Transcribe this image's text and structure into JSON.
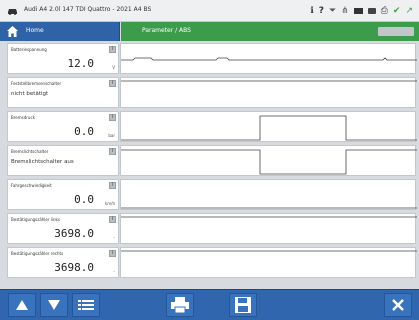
{
  "titlebar": {
    "title": "Audi A4 2.0l 147 TDI Quattro - 2021 A4 BS"
  },
  "header": {
    "home_label": "Home",
    "param_title": "Parameter / ABS"
  },
  "rows": [
    {
      "label": "Batteriespannung",
      "value": "12.0",
      "unit": "V"
    },
    {
      "label": "Feststellbremsenschalter",
      "text_value": "nicht betätigt"
    },
    {
      "label": "Bremsdruck",
      "value": "0.0",
      "unit": "bar"
    },
    {
      "label": "Bremslichtschalter",
      "text_value": "Bremslichtschalter aus"
    },
    {
      "label": "Fahrgeschwindigkeit",
      "value": "0.0",
      "unit": "km/h"
    },
    {
      "label": "Bestätigungszähler links",
      "value": "3698.0",
      "unit": "-"
    },
    {
      "label": "Bestätigungszähler rechts",
      "value": "3698.0",
      "unit": "-"
    }
  ],
  "colors": {
    "toolbar": "#2f66ad",
    "param_bar": "#3d9b4c",
    "home_tab": "#2e63a8"
  }
}
